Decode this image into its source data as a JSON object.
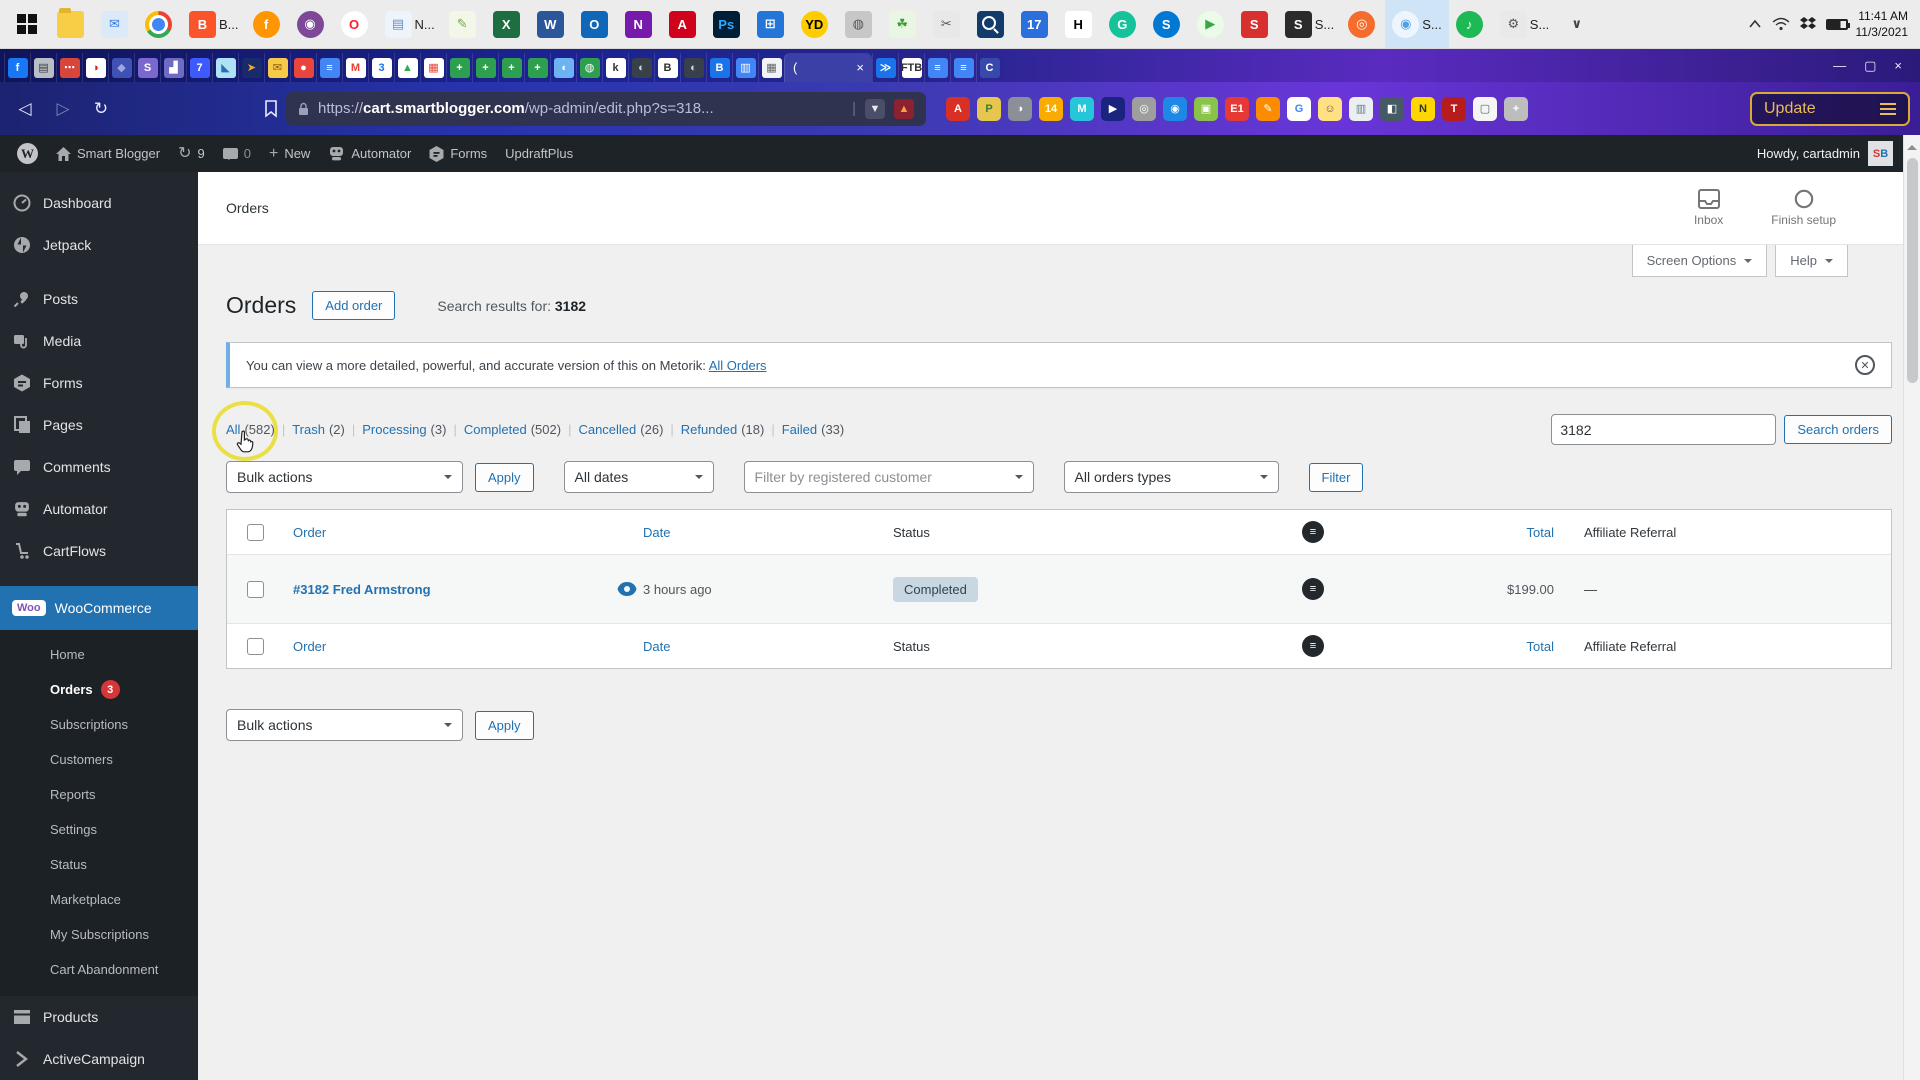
{
  "taskbar": {
    "icons": [
      {
        "g": "",
        "cls": "folder"
      },
      {
        "g": "✉",
        "b": "#dbe9f9",
        "c": "#3c7bd9"
      },
      {
        "g": "",
        "cls": "chrome"
      },
      {
        "g": "B",
        "b": "#fb542b",
        "c": "#ffffff",
        "label": "B..."
      },
      {
        "g": "f",
        "b": "#ff9500",
        "c": "#ffffff",
        "cls": "round"
      },
      {
        "g": "◉",
        "b": "#7e4798",
        "c": "#ffffff",
        "cls": "round"
      },
      {
        "g": "O",
        "b": "#ffffff",
        "c": "#ff1b2d",
        "cls": "round"
      },
      {
        "g": "▤",
        "b": "#eef4fb",
        "c": "#6b8fc3",
        "label": "N..."
      },
      {
        "g": "✎",
        "b": "#f2f7e8",
        "c": "#7aa14d"
      },
      {
        "g": "X",
        "b": "#1d6f42",
        "c": "#ffffff"
      },
      {
        "g": "W",
        "b": "#2b579a",
        "c": "#ffffff"
      },
      {
        "g": "O",
        "b": "#1066b8",
        "c": "#ffffff"
      },
      {
        "g": "N",
        "b": "#7719aa",
        "c": "#ffffff"
      },
      {
        "g": "A",
        "b": "#d0021b",
        "c": "#ffffff"
      },
      {
        "g": "Ps",
        "b": "#001e36",
        "c": "#31a8ff"
      },
      {
        "g": "⊞",
        "b": "#2475d8",
        "c": "#ffffff"
      },
      {
        "g": "YD",
        "b": "#ffcc00",
        "c": "#000000",
        "cls": "round"
      },
      {
        "g": "◍",
        "b": "#c7c7c7",
        "c": "#555555"
      },
      {
        "g": "☘",
        "b": "#eaf6e4",
        "c": "#3f9d3a"
      },
      {
        "g": "✂",
        "b": "#e8e8e8",
        "c": "#555555"
      },
      {
        "g": "",
        "cls": "mag"
      },
      {
        "g": "17",
        "b": "#2a6fdb",
        "c": "#ffffff"
      },
      {
        "g": "H",
        "b": "#ffffff",
        "c": "#000000"
      },
      {
        "g": "G",
        "b": "#15c39a",
        "c": "#ffffff",
        "cls": "round"
      },
      {
        "g": "S",
        "b": "#0078d4",
        "c": "#ffffff",
        "cls": "round"
      },
      {
        "g": "▶",
        "b": "#eafbe7",
        "c": "#35a845",
        "cls": "round"
      },
      {
        "g": "S",
        "b": "#d7302f",
        "c": "#ffffff"
      },
      {
        "g": "S",
        "b": "#2b2b2b",
        "c": "#ffffff",
        "label": "S..."
      },
      {
        "g": "◎",
        "b": "#f56c2d",
        "c": "#ffffff",
        "cls": "round"
      },
      {
        "g": "◉",
        "b": "#eef6fd",
        "c": "#4aa3e8",
        "cls": "round",
        "active": "active",
        "label": "S..."
      },
      {
        "g": "♪",
        "b": "#1db954",
        "c": "#ffffff",
        "cls": "round"
      },
      {
        "g": "⚙",
        "b": "#e9e9e9",
        "c": "#555555",
        "label": "S..."
      },
      {
        "g": "∨",
        "b": "transparent",
        "c": "#444444"
      }
    ],
    "time": "11:41 AM",
    "date": "11/3/2021"
  },
  "tabstrip": {
    "tabs_left": [
      {
        "g": "f",
        "b": "#1877f2",
        "c": "#ffffff"
      },
      {
        "g": "▤",
        "b": "#b9bdc4",
        "c": "#3a3f45"
      },
      {
        "g": "⋯",
        "b": "#d8453a",
        "c": "#ffffff"
      },
      {
        "g": "◑",
        "b": "#ffffff",
        "c": "#cc2222"
      },
      {
        "g": "◆",
        "b": "#3f51b5",
        "c": "#9fa8da"
      },
      {
        "g": "S",
        "b": "#7b68ce",
        "c": "#ffffff"
      },
      {
        "g": "▟",
        "b": "#6f6ac2",
        "c": "#ffffff"
      },
      {
        "g": "7",
        "b": "#3d5afe",
        "c": "#ffffff"
      },
      {
        "g": "◣",
        "b": "#aee3f7",
        "c": "#2a6db0"
      },
      {
        "g": "➤",
        "b": "#1a2b6b",
        "c": "#f5a623"
      },
      {
        "g": "✉",
        "b": "#f7c948",
        "c": "#8a5a00"
      },
      {
        "g": "●",
        "b": "#e8453c",
        "c": "#ffffff"
      },
      {
        "g": "≡",
        "b": "#4285f4",
        "c": "#ffffff"
      },
      {
        "g": "M",
        "b": "#ffffff",
        "c": "#ea4335"
      },
      {
        "g": "3",
        "b": "#ffffff",
        "c": "#1a73e8"
      },
      {
        "g": "▲",
        "b": "#ffffff",
        "c": "#34a853"
      },
      {
        "g": "▦",
        "b": "#ffffff",
        "c": "#ea4335"
      },
      {
        "g": "+",
        "b": "#2e9e4f",
        "c": "#ffffff"
      },
      {
        "g": "+",
        "b": "#2e9e4f",
        "c": "#ffffff"
      },
      {
        "g": "+",
        "b": "#2e9e4f",
        "c": "#ffffff"
      },
      {
        "g": "+",
        "b": "#2e9e4f",
        "c": "#ffffff"
      },
      {
        "g": "◖",
        "b": "#6db3f2",
        "c": "#ffffff"
      },
      {
        "g": "◍",
        "b": "#2e9e4f",
        "c": "#ffffff"
      },
      {
        "g": "k",
        "b": "#ffffff",
        "c": "#333333"
      },
      {
        "g": "◐",
        "b": "#38414a",
        "c": "#cfd8dc"
      },
      {
        "g": "B",
        "b": "#ffffff",
        "c": "#333333"
      },
      {
        "g": "◐",
        "b": "#38414a",
        "c": "#cfd8dc"
      },
      {
        "g": "B",
        "b": "#1a73e8",
        "c": "#ffffff"
      },
      {
        "g": "▥",
        "b": "#4285f4",
        "c": "#ffffff"
      },
      {
        "g": "▦",
        "b": "#f1f3f4",
        "c": "#5f6368"
      }
    ],
    "active_label": "(",
    "active_close": "×",
    "tabs_right": [
      {
        "g": "≫",
        "b": "#1a73e8",
        "c": "#ffffff"
      },
      {
        "g": "FTB",
        "b": "#ffffff",
        "c": "#333333"
      },
      {
        "g": "≡",
        "b": "#4285f4",
        "c": "#ffffff"
      },
      {
        "g": "≡",
        "b": "#4285f4",
        "c": "#ffffff"
      },
      {
        "g": "C",
        "b": "#3949ab",
        "c": "#ffffff"
      }
    ],
    "win_min": "—",
    "win_max": "▢",
    "win_close": "×"
  },
  "browser": {
    "back": "◁",
    "forward": "▷",
    "reload": "↻",
    "lock": "🔒",
    "url_prefix": "https://",
    "url_host": "cart.smartblogger.com",
    "url_path": "/wp-admin/edit.php?s=318...",
    "url_sep": "|",
    "shield_ic": {
      "g": "▼",
      "b": "#4a4e69",
      "c": "#e8e8e8"
    },
    "triangle_ic": {
      "g": "▲",
      "b": "#8c2230",
      "c": "#f2a33c"
    },
    "extensions": [
      {
        "g": "A",
        "b": "#d93025",
        "c": "#ffffff"
      },
      {
        "g": "P",
        "b": "#e7c64f",
        "c": "#3a7d2c"
      },
      {
        "g": "◑",
        "b": "#8a8f98",
        "c": "#ffffff"
      },
      {
        "g": "14",
        "b": "#f9ab00",
        "c": "#ffffff"
      },
      {
        "g": "M",
        "b": "#26c6da",
        "c": "#ffffff"
      },
      {
        "g": "▶",
        "b": "#1a237e",
        "c": "#ffffff"
      },
      {
        "g": "◎",
        "b": "#9e9e9e",
        "c": "#ffffff"
      },
      {
        "g": "◉",
        "b": "#1e88e5",
        "c": "#ffffff"
      },
      {
        "g": "▣",
        "b": "#8bc34a",
        "c": "#ffffff"
      },
      {
        "g": "E1",
        "b": "#e53935",
        "c": "#ffffff"
      },
      {
        "g": "✎",
        "b": "#fb8c00",
        "c": "#ffffff"
      },
      {
        "g": "G",
        "b": "#ffffff",
        "c": "#4285f4"
      },
      {
        "g": "☺",
        "b": "#ffe082",
        "c": "#6d4c41"
      },
      {
        "g": "▥",
        "b": "#eceff1",
        "c": "#607d8b"
      },
      {
        "g": "◧",
        "b": "#455a64",
        "c": "#ffffff"
      },
      {
        "g": "N",
        "b": "#ffd600",
        "c": "#333333"
      },
      {
        "g": "T",
        "b": "#b71c1c",
        "c": "#ffffff"
      },
      {
        "g": "▢",
        "b": "#f5f5f5",
        "c": "#616161"
      },
      {
        "g": "+",
        "b": "#bdbdbd",
        "c": "#ffffff"
      }
    ],
    "update_label": "Update"
  },
  "adminbar": {
    "wp": "W",
    "site": "Smart Blogger",
    "updates": "9",
    "comments": "0",
    "plus": "+",
    "new": "New",
    "automator": "Automator",
    "forms": "Forms",
    "updraft": "UpdraftPlus",
    "howdy": "Howdy, cartadmin",
    "avatar_s": "S",
    "avatar_b": "B"
  },
  "sidebar": {
    "items": [
      {
        "label": "Dashboard"
      },
      {
        "label": "Jetpack"
      },
      {
        "label": "Posts"
      },
      {
        "label": "Media"
      },
      {
        "label": "Forms"
      },
      {
        "label": "Pages"
      },
      {
        "label": "Comments"
      },
      {
        "label": "Automator"
      },
      {
        "label": "CartFlows"
      }
    ],
    "woo_badge": "Woo",
    "woo_label": "WooCommerce",
    "submenu": [
      {
        "label": "Home"
      },
      {
        "label": "Orders",
        "badge": "3",
        "current": true
      },
      {
        "label": "Subscriptions"
      },
      {
        "label": "Customers"
      },
      {
        "label": "Reports"
      },
      {
        "label": "Settings"
      },
      {
        "label": "Status"
      },
      {
        "label": "Marketplace"
      },
      {
        "label": "My Subscriptions"
      },
      {
        "label": "Cart Abandonment"
      }
    ],
    "products": "Products",
    "activecampaign": "ActiveCampaign",
    "orders_badge": "3"
  },
  "content": {
    "breadcrumb": "Orders",
    "inbox": "Inbox",
    "finish_setup": "Finish setup",
    "screen_options": "Screen Options",
    "help": "Help",
    "title": "Orders",
    "add_order": "Add order",
    "search_results_label": "Search results for:",
    "search_results_term": "3182",
    "notice_text": "You can view a more detailed, powerful, and accurate version of this on Metorik:",
    "notice_link": "All Orders",
    "dismiss": "✕",
    "views": [
      {
        "label": "All",
        "count": "(582)",
        "sep": "|"
      },
      {
        "label": "Trash",
        "count": "(2)",
        "sep": "|"
      },
      {
        "label": "Processing",
        "count": "(3)",
        "sep": "|"
      },
      {
        "label": "Completed",
        "count": "(502)",
        "sep": "|"
      },
      {
        "label": "Cancelled",
        "count": "(26)",
        "sep": "|"
      },
      {
        "label": "Refunded",
        "count": "(18)",
        "sep": "|"
      },
      {
        "label": "Failed",
        "count": "(33)",
        "sep": ""
      }
    ],
    "search_value": "3182",
    "search_button": "Search orders",
    "bulk_actions": "Bulk actions",
    "apply": "Apply",
    "all_dates": "All dates",
    "customer_filter": "Filter by registered customer",
    "order_types": "All orders types",
    "filter": "Filter",
    "table": {
      "col_order": "Order",
      "col_date": "Date",
      "col_status": "Status",
      "col_total": "Total",
      "col_affiliate": "Affiliate Referral",
      "note_glyph": "≡",
      "row": {
        "order": "#3182 Fred Armstrong",
        "date": "3 hours ago",
        "status": "Completed",
        "total": "$199.00",
        "affiliate": "—"
      }
    }
  }
}
